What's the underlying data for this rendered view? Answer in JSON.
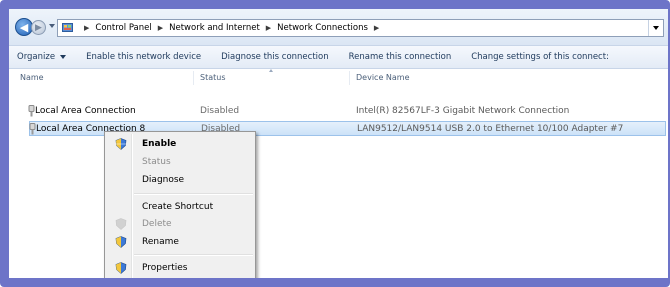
{
  "address": {
    "crumbs": [
      "Control Panel",
      "Network and Internet",
      "Network Connections"
    ]
  },
  "toolbar": {
    "organize": "Organize",
    "enable_device": "Enable this network device",
    "diagnose": "Diagnose this connection",
    "rename": "Rename this connection",
    "change_settings": "Change settings of this connect:"
  },
  "columns": {
    "name": "Name",
    "status": "Status",
    "device": "Device Name"
  },
  "rows": [
    {
      "name": "Local Area Connection",
      "status": "Disabled",
      "device": "Intel(R) 82567LF-3 Gigabit Network Connection"
    },
    {
      "name": "Local Area Connection 8",
      "status": "Disabled",
      "device": "LAN9512/LAN9514 USB 2.0 to Ethernet 10/100 Adapter #7"
    }
  ],
  "context_menu": {
    "enable": "Enable",
    "status": "Status",
    "diagnose": "Diagnose",
    "create_shortcut": "Create Shortcut",
    "delete": "Delete",
    "rename": "Rename",
    "properties": "Properties"
  },
  "colors": {
    "frame": "#6d74c8",
    "selection": "#cce2f8",
    "link_text": "#1e395b"
  },
  "icons": {
    "back": "arrow-left-icon",
    "forward": "arrow-right-icon",
    "control_panel": "control-panel-icon",
    "network": "network-adapter-icon",
    "shield": "uac-shield-icon"
  }
}
